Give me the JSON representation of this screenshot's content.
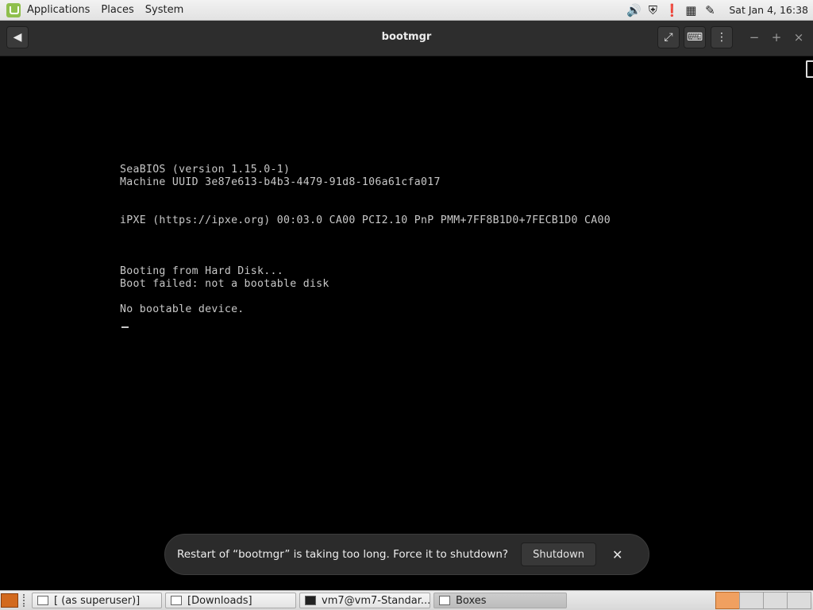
{
  "top_panel": {
    "menus": [
      "Applications",
      "Places",
      "System"
    ],
    "clock": "Sat Jan  4, 16:38",
    "tray_icons": [
      "volume-icon",
      "shield-icon",
      "clipboard-icon",
      "calendar-icon",
      "network-icon"
    ]
  },
  "window": {
    "title": "bootmgr"
  },
  "console": {
    "lines": [
      "SeaBIOS (version 1.15.0-1)",
      "Machine UUID 3e87e613-b4b3-4479-91d8-106a61cfa017",
      "iPXE (https://ipxe.org) 00:03.0 CA00 PCI2.10 PnP PMM+7FF8B1D0+7FECB1D0 CA00",
      "Booting from Hard Disk...",
      "Boot failed: not a bootable disk",
      "No bootable device."
    ]
  },
  "notification": {
    "message": "Restart of “bootmgr” is taking too long. Force it to shutdown?",
    "button": "Shutdown"
  },
  "taskbar": {
    "tasks": [
      {
        "label": "[ (as superuser)]",
        "active": false
      },
      {
        "label": "[Downloads]",
        "active": false
      },
      {
        "label": "vm7@vm7-Standar...",
        "active": false
      },
      {
        "label": "Boxes",
        "active": true
      }
    ]
  },
  "colors": {
    "console_bg": "#000000",
    "console_text": "#c8c8c8",
    "titlebar_bg": "#2d2d2d",
    "toast_bg": "#2b2b2b",
    "active_workspace": "#f0a060"
  }
}
